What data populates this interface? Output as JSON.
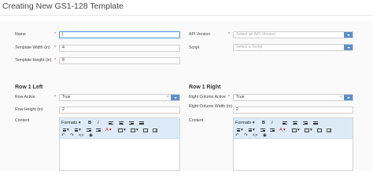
{
  "header": {
    "title": "Creating New GS1-128 Template"
  },
  "required_marker": "*",
  "form_left": {
    "name": {
      "label": "Name",
      "value": "|"
    },
    "template_width": {
      "label": "Template Width (in)",
      "value": "4"
    },
    "template_height": {
      "label": "Template Height (in)",
      "value": "8"
    }
  },
  "form_right": {
    "api_version": {
      "label": "API Version",
      "placeholder": "Select an API Version"
    },
    "script": {
      "label": "Script",
      "placeholder": "Select a Script"
    }
  },
  "row1_left": {
    "section_title": "Row 1 Left",
    "row_active": {
      "label": "Row Active",
      "value": "True",
      "clear": "×"
    },
    "row_height": {
      "label": "Row Height (in)",
      "value": "2"
    },
    "content": {
      "label": "Content"
    }
  },
  "row1_right": {
    "section_title": "Row 1 Right",
    "column_active": {
      "label": "Right Column Active",
      "value": "True",
      "clear": "×"
    },
    "column_width": {
      "label": "Right Column Width (in)",
      "value": "2"
    },
    "content": {
      "label": "Content"
    }
  },
  "editor_toolbar": {
    "formats": "Formats ▾",
    "bold": "B",
    "italic": "I",
    "font_color": "A ▾",
    "code": "<>",
    "undo": "↶",
    "redo": "↷",
    "preview": "◉",
    "caret": "▾"
  },
  "colors": {
    "accent": "#5b8fc7",
    "toolbar_bg": "#dcebf7",
    "required": "#c0392b"
  }
}
